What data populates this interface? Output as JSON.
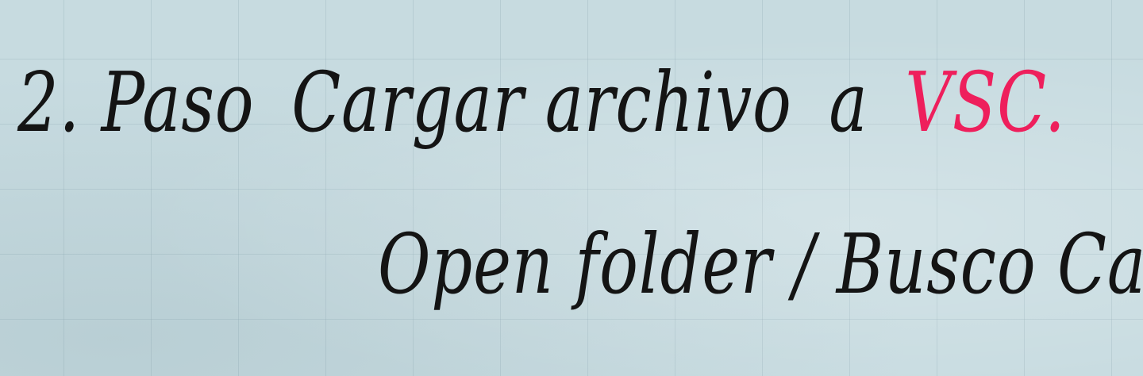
{
  "whiteboard": {
    "line1": {
      "step": "2. Paso",
      "action": "Cargar archivo",
      "preposition": "a",
      "target": "VSC."
    },
    "line2": {
      "text": "Open folder / Busco Carpeta"
    }
  },
  "colors": {
    "board": "#c7dbe0",
    "ink": "#141414",
    "accent_ink": "#ee1f5c"
  }
}
